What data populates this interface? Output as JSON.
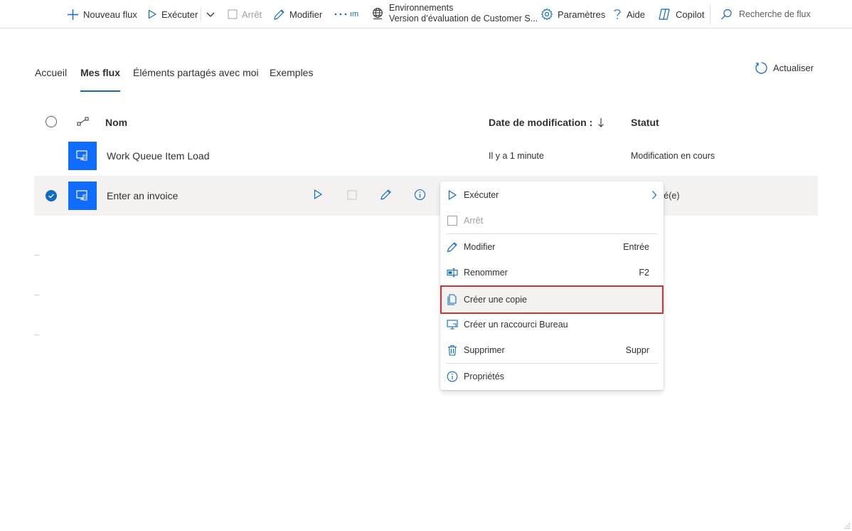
{
  "toolbar": {
    "new_flow": "Nouveau flux",
    "run": "Exécuter",
    "stop": "Arrêt",
    "edit": "Modifier",
    "more_suffix": "ım",
    "environments_label": "Environnements",
    "environment_value": "Version d’évaluation de Customer S...",
    "settings": "Paramètres",
    "help": "Aide",
    "copilot": "Copilot",
    "search_placeholder": "Recherche de flux"
  },
  "tabs": [
    {
      "label": "Accueil",
      "active": false
    },
    {
      "label": "Mes flux",
      "active": true
    },
    {
      "label": "Éléments partagés avec moi",
      "active": false
    },
    {
      "label": "Exemples",
      "active": false
    }
  ],
  "refresh_label": "Actualiser",
  "table": {
    "columns": {
      "name": "Nom",
      "modified": "Date de modification :",
      "status": "Statut"
    },
    "rows": [
      {
        "name": "Work Queue Item Load",
        "modified": "Il y a 1 minute",
        "status": "Modification en cours",
        "selected": false
      },
      {
        "name": "Enter an invoice",
        "modified": "",
        "status": "vé(e)",
        "selected": true
      }
    ]
  },
  "context_menu": {
    "items": [
      {
        "label": "Exécuter",
        "key": "",
        "icon": "play-icon",
        "disabled": false,
        "submenu": true
      },
      {
        "label": "Arrêt",
        "key": "",
        "icon": "stop-icon",
        "disabled": true
      },
      {
        "label": "Modifier",
        "key": "Entrée",
        "icon": "pencil-icon",
        "disabled": false
      },
      {
        "label": "Renommer",
        "key": "F2",
        "icon": "rename-icon",
        "disabled": false
      },
      {
        "label": "Créer une copie",
        "key": "",
        "icon": "copy-icon",
        "disabled": false,
        "highlighted": true
      },
      {
        "label": "Créer un raccourci Bureau",
        "key": "",
        "icon": "desktop-shortcut-icon",
        "disabled": false
      },
      {
        "label": "Supprimer",
        "key": "Suppr",
        "icon": "trash-icon",
        "disabled": false
      },
      {
        "label": "Propriétés",
        "key": "",
        "icon": "info-icon",
        "disabled": false
      }
    ]
  },
  "colors": {
    "accent": "#0f6cbd",
    "flow_icon_bg": "#0f6cfd",
    "highlight_border": "#d13438",
    "selected_row_bg": "#f3f2f1"
  }
}
